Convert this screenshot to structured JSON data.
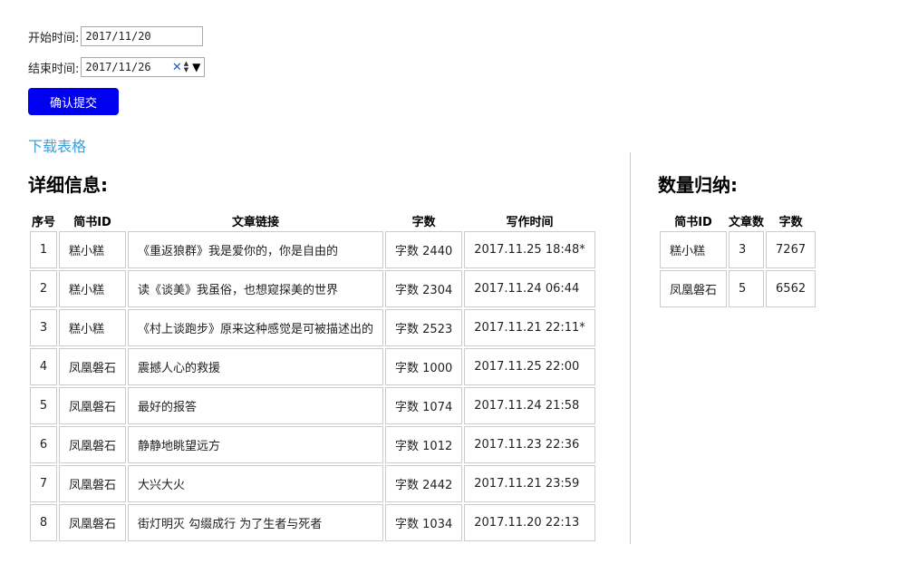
{
  "form": {
    "start_label": "开始时间:",
    "start_value": "2017/11/20",
    "end_label": "结束时间:",
    "end_value": "2017/11/26",
    "submit_label": "确认提交"
  },
  "download_label": "下载表格",
  "detail": {
    "title": "详细信息:",
    "headers": [
      "序号",
      "简书ID",
      "文章链接",
      "字数",
      "写作时间"
    ],
    "rows": [
      [
        "1",
        "糕小糕",
        "《重返狼群》我是爱你的，你是自由的",
        "字数 2440",
        "2017.11.25 18:48*"
      ],
      [
        "2",
        "糕小糕",
        "读《谈美》我虽俗，也想窥探美的世界",
        "字数 2304",
        "2017.11.24 06:44"
      ],
      [
        "3",
        "糕小糕",
        "《村上谈跑步》原来这种感觉是可被描述出的",
        "字数 2523",
        "2017.11.21 22:11*"
      ],
      [
        "4",
        "凤凰磐石",
        "震撼人心的救援",
        "字数 1000",
        "2017.11.25 22:00"
      ],
      [
        "5",
        "凤凰磐石",
        "最好的报答",
        "字数 1074",
        "2017.11.24 21:58"
      ],
      [
        "6",
        "凤凰磐石",
        "静静地眺望远方",
        "字数 1012",
        "2017.11.23 22:36"
      ],
      [
        "7",
        "凤凰磐石",
        "大兴大火",
        "字数 2442",
        "2017.11.21 23:59"
      ],
      [
        "8",
        "凤凰磐石",
        "街灯明灭 勾缀成行 为了生者与死者",
        "字数 1034",
        "2017.11.20 22:13"
      ]
    ]
  },
  "summary": {
    "title": "数量归纳:",
    "headers": [
      "简书ID",
      "文章数",
      "字数"
    ],
    "rows": [
      [
        "糕小糕",
        "3",
        "7267"
      ],
      [
        "凤凰磐石",
        "5",
        "6562"
      ]
    ]
  },
  "icons": {
    "clear": "clear-icon",
    "spinner": "spinner-icon",
    "dropdown": "dropdown-arrow-icon"
  }
}
